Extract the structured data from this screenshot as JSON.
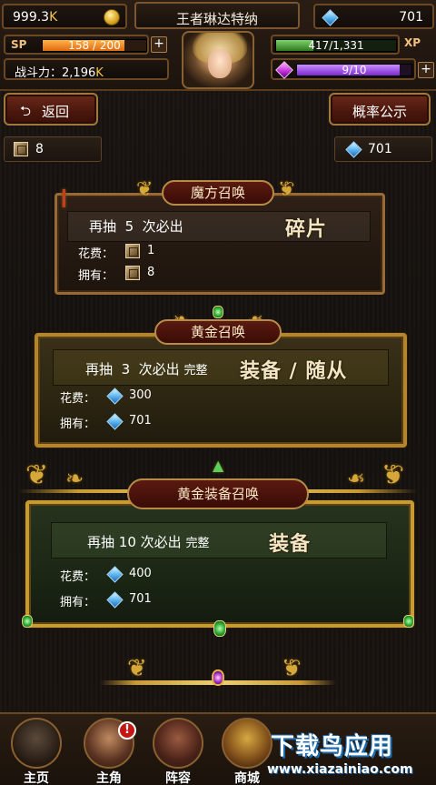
{
  "hud": {
    "gold_value": "999.3",
    "gold_suffix": "K",
    "player_name": "王者琳达特纳",
    "diamonds": "701",
    "sp_label": "SP",
    "sp_text": "158 / 200",
    "sp_ratio": 0.79,
    "power_label": "战斗力：",
    "power_value": "2,196",
    "power_suffix": "K",
    "xp_text": "417/1,331",
    "xp_ratio": 0.313,
    "xp_label": "XP",
    "gem_text": "9/10",
    "gem_ratio": 0.9,
    "plus": "+"
  },
  "actions": {
    "back_arrow": "⮌",
    "back_label": "返回",
    "probability_label": "概率公示"
  },
  "resources": {
    "cubes": "8",
    "diamonds": "701"
  },
  "panels": {
    "cube": {
      "title": "魔方召唤",
      "draw_prefix": "再抽",
      "draw_count": "5",
      "draw_suffix": "次必出",
      "reward": "碎片",
      "cost_label": "花费：",
      "cost_value": "1",
      "own_label": "拥有：",
      "own_value": "8"
    },
    "gold": {
      "title": "黄金召唤",
      "draw_prefix": "再抽",
      "draw_count": "3",
      "draw_suffix": "次必出",
      "complete": "完整",
      "reward": "装备 / 随从",
      "cost_label": "花费：",
      "cost_value": "300",
      "own_label": "拥有：",
      "own_value": "701"
    },
    "gold_equip": {
      "title": "黄金装备召唤",
      "draw_prefix": "再抽",
      "draw_count": "10",
      "draw_suffix": "次必出",
      "complete": "完整",
      "reward": "装备",
      "cost_label": "花费：",
      "cost_value": "400",
      "own_label": "拥有：",
      "own_value": "701"
    }
  },
  "nav": {
    "items": [
      {
        "label": "主页",
        "icon": "home-emblem-icon"
      },
      {
        "label": "主角",
        "icon": "hero-portrait-icon",
        "badge": "!"
      },
      {
        "label": "阵容",
        "icon": "formation-helmet-icon"
      },
      {
        "label": "商城",
        "icon": "treasure-chest-icon"
      }
    ]
  },
  "watermark": {
    "main": "下载鸟应用",
    "url": "www.xiazainiao.com"
  },
  "colors": {
    "accent_gold": "#f3c84a",
    "sp_orange": "#e06a10",
    "xp_green": "#2c7a1f",
    "gem_purple": "#7c2ad0",
    "button_red": "#4a160c"
  }
}
